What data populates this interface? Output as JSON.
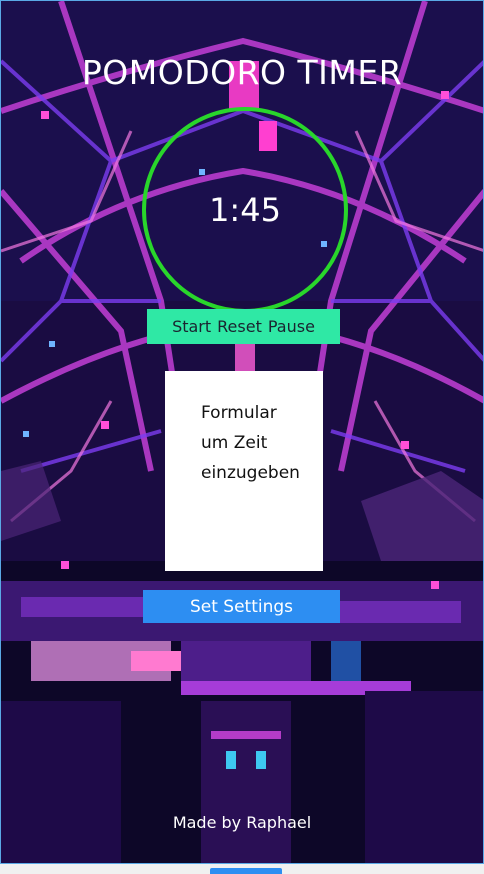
{
  "header": {
    "title": "POMODORO TIMER"
  },
  "timer": {
    "time": "1:45",
    "ring_color": "#29d62b"
  },
  "controls": {
    "start_label": "Start",
    "reset_label": "Reset",
    "pause_label": "Pause",
    "bg_color": "#2fe8a5"
  },
  "form": {
    "line1": "Formular",
    "line2": "um Zeit",
    "line3": "einzugeben"
  },
  "settings": {
    "button_label": "Set Settings",
    "bg_color": "#2d8ef2"
  },
  "footer": {
    "credit": "Made by Raphael"
  }
}
